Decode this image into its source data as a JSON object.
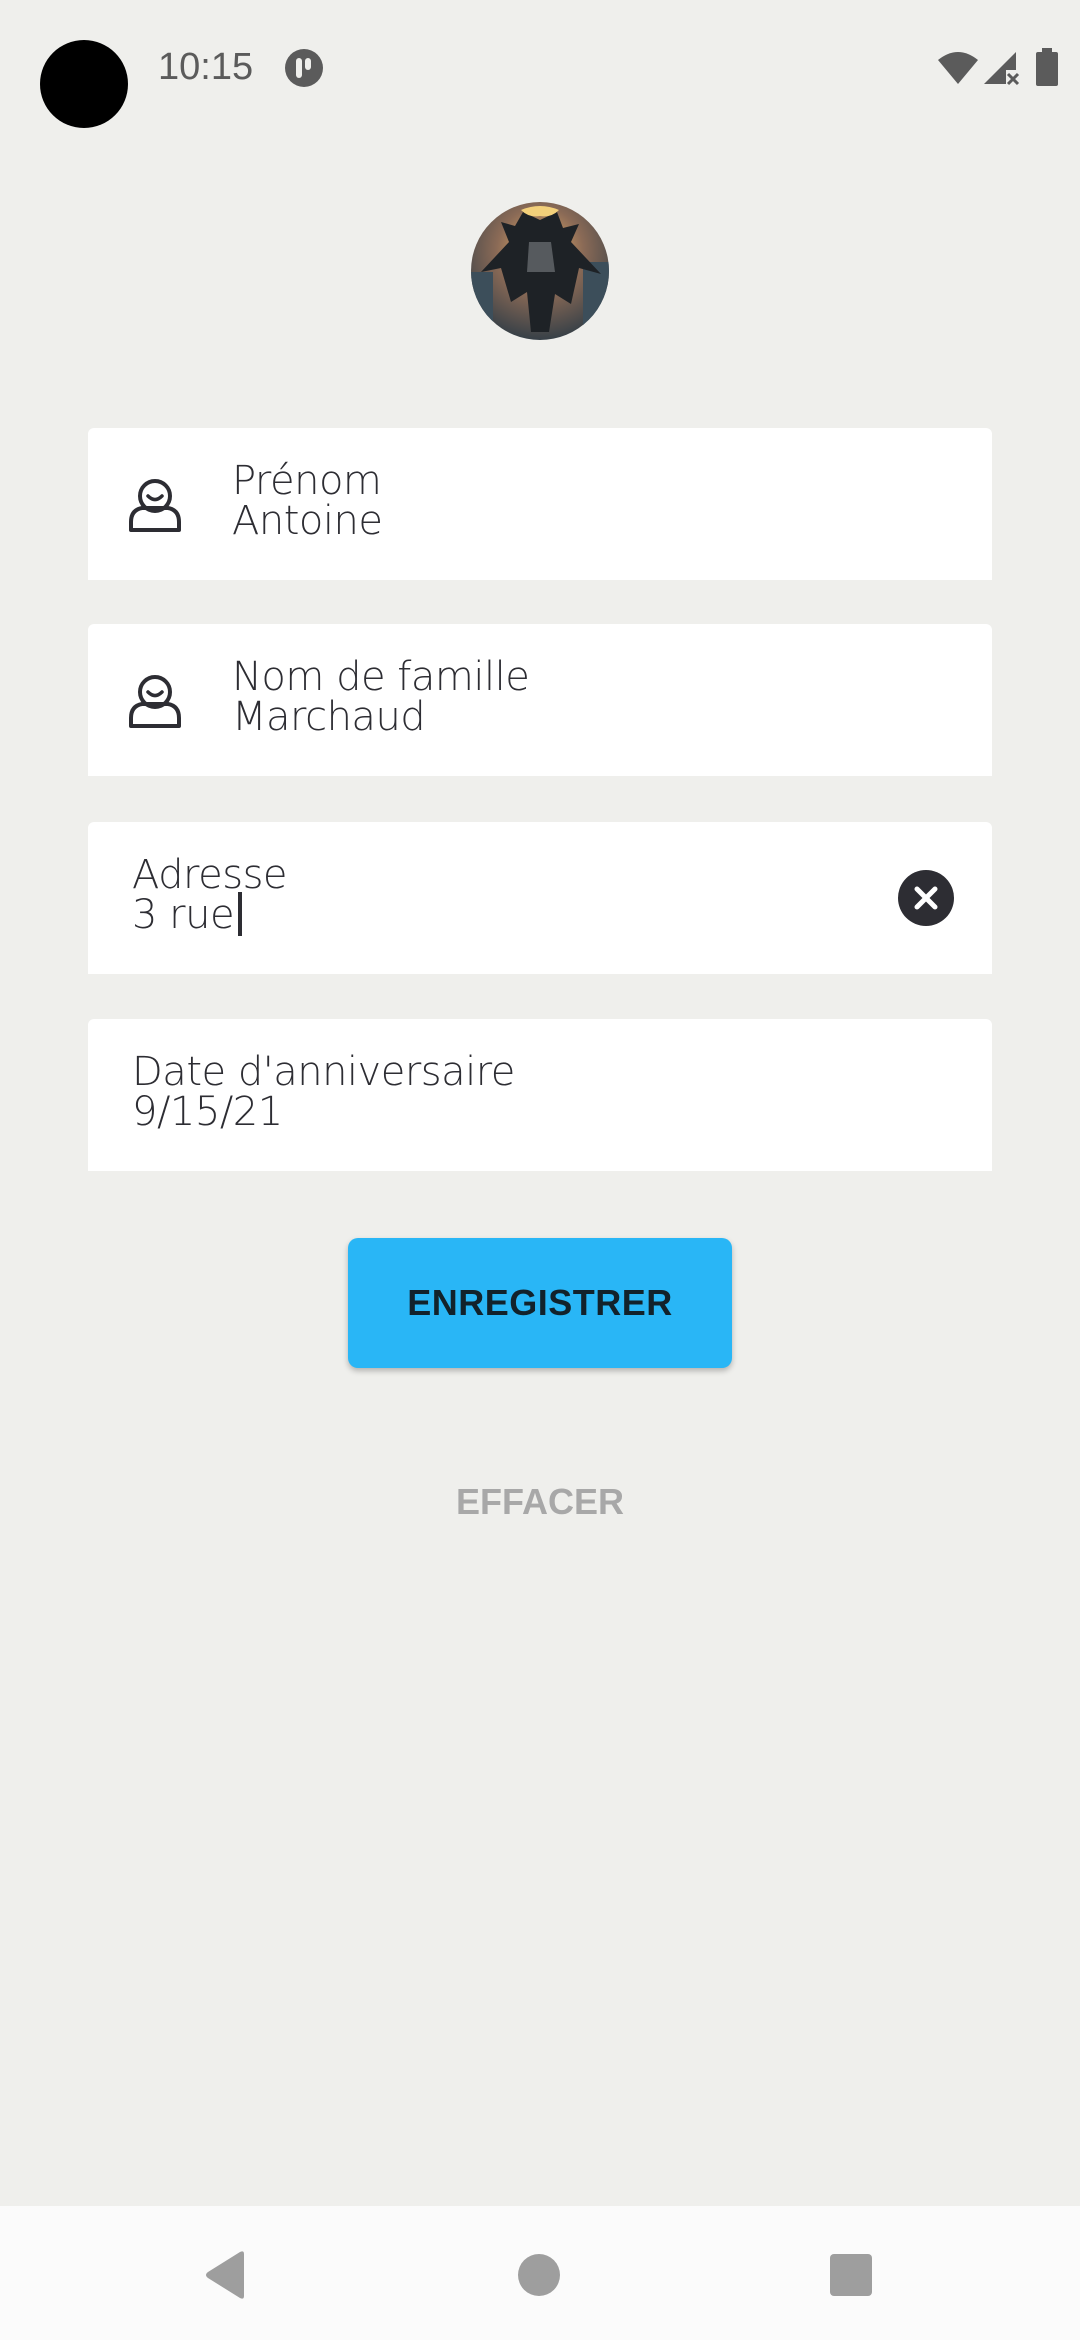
{
  "status_bar": {
    "time": "10:15"
  },
  "form": {
    "first_name": {
      "label": "Prénom",
      "value": "Antoine",
      "icon": "person-icon"
    },
    "last_name": {
      "label": "Nom de famille",
      "value": "Marchaud",
      "icon": "person-icon"
    },
    "address": {
      "label": "Adresse",
      "value": "3 rue",
      "clear_icon": "clear-icon"
    },
    "birthday": {
      "label": "Date d'anniversaire",
      "value": "9/15/21"
    }
  },
  "actions": {
    "save_label": "ENREGISTRER",
    "clear_label": "EFFACER"
  },
  "colors": {
    "accent": "#29b6f6",
    "background": "#efefec",
    "field": "#ffffff",
    "text": "#2d2d33"
  }
}
